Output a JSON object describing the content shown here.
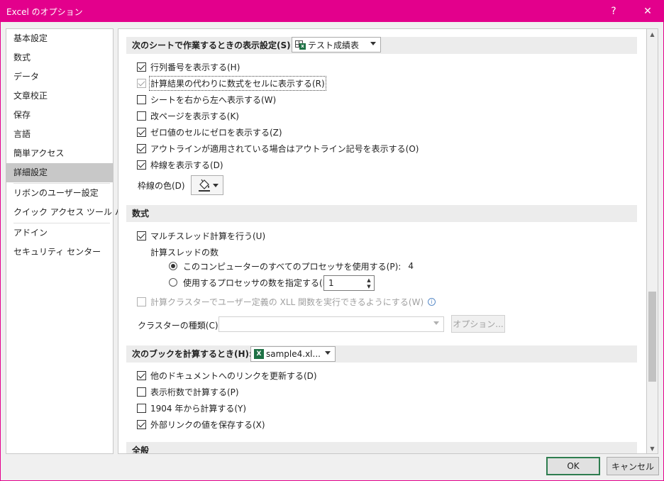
{
  "window": {
    "title": "Excel のオプション",
    "help": "?",
    "close": "✕"
  },
  "nav": {
    "items": [
      {
        "label": "基本設定"
      },
      {
        "label": "数式"
      },
      {
        "label": "データ"
      },
      {
        "label": "文章校正"
      },
      {
        "label": "保存"
      },
      {
        "label": "言語"
      },
      {
        "label": "簡単アクセス"
      },
      {
        "label": "詳細設定"
      },
      {
        "label": "リボンのユーザー設定"
      },
      {
        "label": "クイック アクセス ツール バー"
      },
      {
        "label": "アドイン"
      },
      {
        "label": "セキュリティ センター"
      }
    ],
    "selected": "詳細設定"
  },
  "sheet_section": {
    "heading": "次のシートで作業するときの表示設定(S):",
    "sheet_dropdown": "テスト成績表",
    "options": [
      {
        "label": "行列番号を表示する(H)",
        "checked": true
      },
      {
        "label": "計算結果の代わりに数式をセルに表示する(R)",
        "checked": true
      },
      {
        "label": "シートを右から左へ表示する(W)",
        "checked": false
      },
      {
        "label": "改ページを表示する(K)",
        "checked": false
      },
      {
        "label": "ゼロ値のセルにゼロを表示する(Z)",
        "checked": true
      },
      {
        "label": "アウトラインが適用されている場合はアウトライン記号を表示する(O)",
        "checked": true
      },
      {
        "label": "枠線を表示する(D)",
        "checked": true
      }
    ],
    "gridline_color_label": "枠線の色(D)"
  },
  "formula_section": {
    "heading": "数式",
    "multithread": {
      "label": "マルチスレッド計算を行う(U)",
      "checked": true
    },
    "thread_count_label": "計算スレッドの数",
    "radio_all": {
      "label": "このコンピューターのすべてのプロセッサを使用する(P):",
      "value": "4"
    },
    "radio_manual": {
      "label": "使用するプロセッサの数を指定する(M):",
      "value": "1"
    },
    "cluster_option": {
      "label": "計算クラスターでユーザー定義の XLL 関数を実行できるようにする(W)",
      "checked": false
    },
    "cluster_type_label": "クラスターの種類(C):",
    "cluster_type_value": "",
    "options_button": "オプション..."
  },
  "workbook_section": {
    "heading": "次のブックを計算するとき(H):",
    "workbook_dropdown": "sample4.xl...",
    "options": [
      {
        "label": "他のドキュメントへのリンクを更新する(D)",
        "checked": true
      },
      {
        "label": "表示桁数で計算する(P)",
        "checked": false
      },
      {
        "label": "1904 年から計算する(Y)",
        "checked": false
      },
      {
        "label": "外部リンクの値を保存する(X)",
        "checked": true
      }
    ]
  },
  "general_section": {
    "heading": "全般"
  },
  "buttons": {
    "ok": "OK",
    "cancel": "キャンセル"
  },
  "colors": {
    "titlebar": "#e3008c",
    "excel_green": "#1e7145"
  }
}
